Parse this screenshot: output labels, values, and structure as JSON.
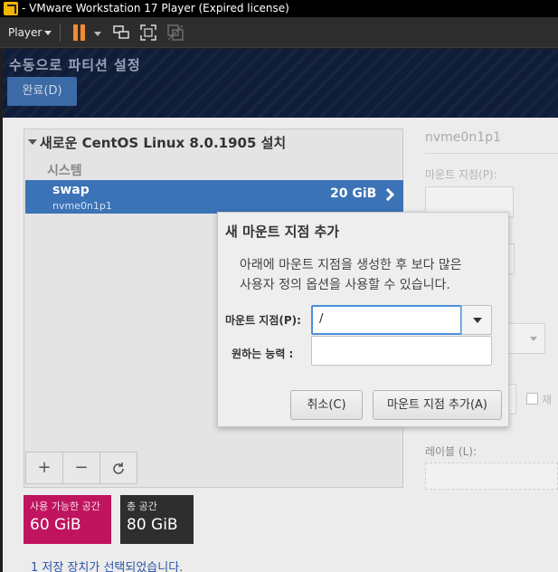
{
  "window": {
    "title": "- VMware Workstation 17 Player (Expired license)"
  },
  "toolbar": {
    "player_menu": "Player",
    "icons": [
      "pause-icon",
      "network-icon",
      "fullscreen-icon",
      "unity-icon"
    ]
  },
  "header": {
    "title": "수동으로 파티션 설정",
    "done_button": "완료(D)"
  },
  "partitions": {
    "install_title": "새로운 CentOS Linux 8.0.1905 설치",
    "system_label": "시스템",
    "items": [
      {
        "name": "swap",
        "device": "nvme0n1p1",
        "size": "20 GiB"
      }
    ],
    "add_icon": "+",
    "remove_icon": "−",
    "refresh_icon": "refresh-icon"
  },
  "summary": {
    "available_label": "사용 가능한 공간",
    "available_value": "60 GiB",
    "total_label": "총 공간",
    "total_value": "80 GiB",
    "storage_link": "1 저장 장치가 선택되었습니다."
  },
  "right_panel": {
    "device": "nvme0n1p1",
    "mount_point_label": "마운트 지점(P):",
    "checkbox_label": "재",
    "label_label": "레이블 (L):"
  },
  "dialog": {
    "title": "새 마운트 지점 추가",
    "description_line1": "아래에 마운트 지점을 생성한 후 보다 많은",
    "description_line2": "사용자 정의 옵션을 사용할 수 있습니다.",
    "mount_point_label": "마운트 지점(P):",
    "mount_point_value": "/",
    "capacity_label": "원하는  능력 :",
    "capacity_value": "",
    "cancel_button": "취소(C)",
    "add_button": "마운트 지점 추가(A)"
  },
  "colors": {
    "header_bg": "#0f1d3a",
    "selected_row": "#3b73b6",
    "available_box": "#c0145f",
    "total_box": "#2e2e2e",
    "focus_border": "#4a90d9"
  }
}
